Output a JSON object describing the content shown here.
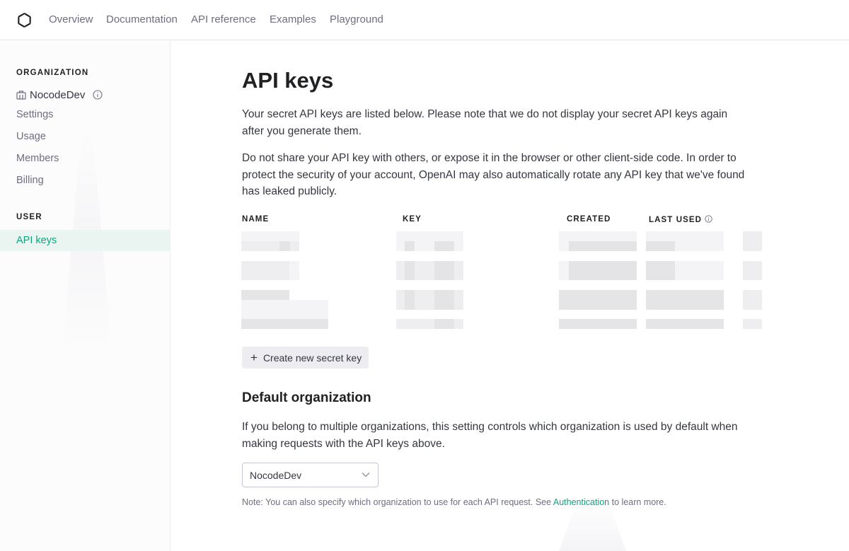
{
  "nav": {
    "links": [
      "Overview",
      "Documentation",
      "API reference",
      "Examples",
      "Playground"
    ]
  },
  "sidebar": {
    "org_heading": "ORGANIZATION",
    "org_name": "NocodeDev",
    "items": [
      "Settings",
      "Usage",
      "Members",
      "Billing"
    ],
    "user_heading": "USER",
    "active_item": "API keys"
  },
  "main": {
    "title": "API keys",
    "intro": "Your secret API keys are listed below. Please note that we do not display your secret API keys again after you generate them.",
    "warning": "Do not share your API key with others, or expose it in the browser or other client-side code. In order to protect the security of your account, OpenAI may also automatically rotate any API key that we've found has leaked publicly.",
    "table": {
      "headers": [
        "NAME",
        "KEY",
        "CREATED",
        "LAST USED"
      ]
    },
    "create_button": "Create new secret key",
    "default_org": {
      "title": "Default organization",
      "description": "If you belong to multiple organizations, this setting controls which organization is used by default when making requests with the API keys above.",
      "selected": "NocodeDev",
      "note_prefix": "Note: You can also specify which organization to use for each API request. See",
      "note_link": "Authentication",
      "note_suffix": "to learn more."
    }
  },
  "colors": {
    "accent": "#10a37f",
    "muted_text": "#6e6e80",
    "active_bg": "#eaf4f0",
    "button_bg": "#ececf1"
  }
}
